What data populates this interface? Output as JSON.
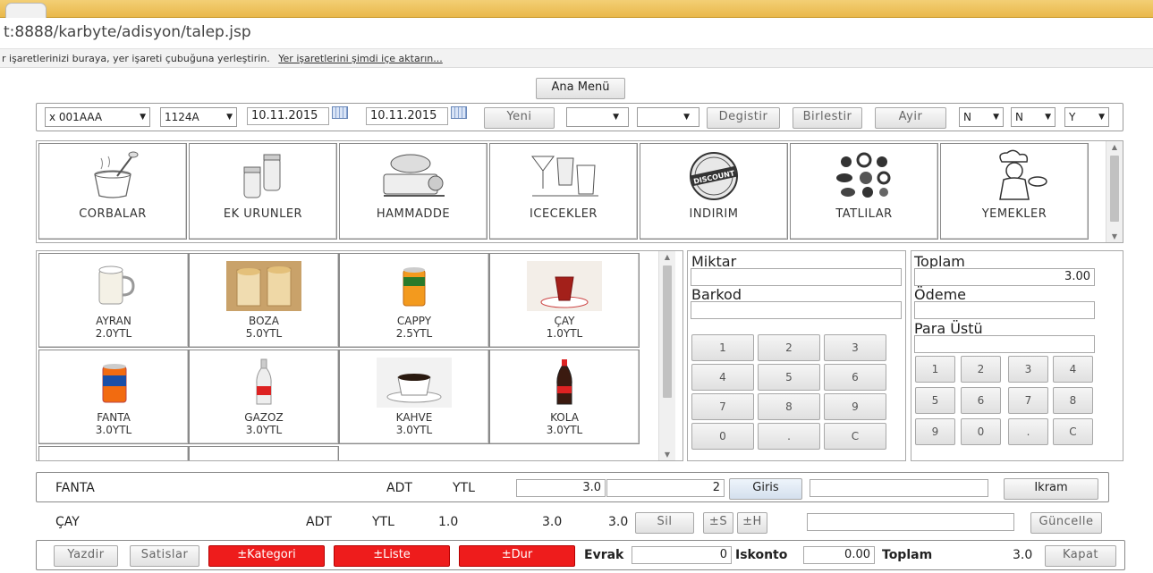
{
  "browser": {
    "url": "t:8888/karbyte/adisyon/talep.jsp",
    "bookmarks_text": "r işaretlerinizi buraya, yer işareti çubuğuna yerleştirin.",
    "bookmarks_link": "Yer işaretlerini şimdi içe aktarın..."
  },
  "menu_button": "Ana Menü",
  "toolbar": {
    "table_select": "x 001AAA",
    "code_select": "1124A",
    "date_from": "10.11.2015",
    "date_to": "10.11.2015",
    "new_button": "Yeni",
    "select_a": "",
    "select_b": "",
    "change_button": "Degistir",
    "merge_button": "Birlestir",
    "split_button": "Ayir",
    "flag1": "N",
    "flag2": "N",
    "flag3": "Y"
  },
  "categories": [
    {
      "label": "CORBALAR",
      "icon": "soup-bowl-icon"
    },
    {
      "label": "EK URUNLER",
      "icon": "salt-shaker-icon"
    },
    {
      "label": "HAMMADDE",
      "icon": "grinder-icon"
    },
    {
      "label": "ICECEKLER",
      "icon": "drink-glasses-icon"
    },
    {
      "label": "INDIRIM",
      "icon": "discount-stamp-icon"
    },
    {
      "label": "TATLILAR",
      "icon": "candy-icon"
    },
    {
      "label": "YEMEKLER",
      "icon": "chef-icon"
    }
  ],
  "products": [
    {
      "name": "AYRAN",
      "price": "2.0YTL",
      "icon": "mug-icon"
    },
    {
      "name": "BOZA",
      "price": "5.0YTL",
      "icon": "boza-glass-icon"
    },
    {
      "name": "CAPPY",
      "price": "2.5YTL",
      "icon": "juice-can-icon"
    },
    {
      "name": "ÇAY",
      "price": "1.0YTL",
      "icon": "tea-glass-icon"
    },
    {
      "name": "FANTA",
      "price": "3.0YTL",
      "icon": "soda-can-icon"
    },
    {
      "name": "GAZOZ",
      "price": "3.0YTL",
      "icon": "soda-bottle-icon"
    },
    {
      "name": "KAHVE",
      "price": "3.0YTL",
      "icon": "coffee-cup-icon"
    },
    {
      "name": "KOLA",
      "price": "3.0YTL",
      "icon": "cola-bottle-icon"
    }
  ],
  "entry_panel": {
    "qty_label": "Miktar",
    "barcode_label": "Barkod",
    "keys": [
      "1",
      "2",
      "3",
      "4",
      "5",
      "6",
      "7",
      "8",
      "9",
      "0",
      ".",
      "C"
    ]
  },
  "payment_panel": {
    "total_label": "Toplam",
    "total_value": "3.00",
    "payment_label": "Ödeme",
    "change_label": "Para Üstü",
    "keys": [
      "1",
      "2",
      "3",
      "4",
      "5",
      "6",
      "7",
      "8",
      "9",
      "0",
      ".",
      "C"
    ]
  },
  "entry_row": {
    "product": "FANTA",
    "unit": "ADT",
    "currency": "YTL",
    "price": "3.0",
    "qty": "2",
    "enter_button": "Giris",
    "note": "",
    "treat_button": "Ikram"
  },
  "order_row": {
    "product": "ÇAY",
    "unit": "ADT",
    "currency": "YTL",
    "unit_price": "1.0",
    "amount1": "3.0",
    "amount2": "3.0",
    "delete_button": "Sil",
    "s_button": "±S",
    "h_button": "±H",
    "note": "",
    "update_button": "Güncelle"
  },
  "footer": {
    "print_button": "Yazdir",
    "sales_button": "Satislar",
    "category_button": "±Kategori",
    "list_button": "±Liste",
    "stop_button": "±Dur",
    "doc_label": "Evrak",
    "doc_value": "0",
    "discount_label": "Iskonto",
    "discount_value": "0.00",
    "total_label": "Toplam",
    "total_value": "3.0",
    "close_button": "Kapat"
  }
}
